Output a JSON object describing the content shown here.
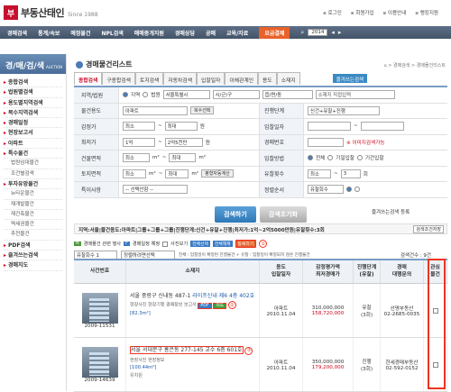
{
  "logo": {
    "mark": "부",
    "name": "부동산태인",
    "since": "Since 1988"
  },
  "toplinks": [
    "로그인",
    "회원가입",
    "이용안내",
    "랭킹지원"
  ],
  "nav": {
    "items": [
      "경매검색",
      "통계/속보",
      "예정물건",
      "NPL검색",
      "매매중개지원",
      "경매상담",
      "공매",
      "교육/자료"
    ],
    "active": "요금결제",
    "year": "2014"
  },
  "sidebar": {
    "title": "경/매/검/색",
    "title_small": "AUCTION",
    "items": [
      {
        "label": "종합검색",
        "type": "main"
      },
      {
        "label": "법원별검색",
        "type": "main"
      },
      {
        "label": "용도별지역검색",
        "type": "main"
      },
      {
        "label": "복수지역검색",
        "type": "main"
      },
      {
        "label": "경매일정",
        "type": "main"
      },
      {
        "label": "현장보고서",
        "type": "main"
      },
      {
        "label": "아파트",
        "type": "main"
      },
      {
        "label": "특수물건",
        "type": "main"
      },
      {
        "label": "법원임대물건",
        "type": "sub"
      },
      {
        "label": "조건별검색",
        "type": "sub"
      },
      {
        "label": "투자유망물건",
        "type": "main"
      },
      {
        "label": "뉴타운물건",
        "type": "sub"
      },
      {
        "label": "재개발물건",
        "type": "sub"
      },
      {
        "label": "재건축물건",
        "type": "sub"
      },
      {
        "label": "역세권물건",
        "type": "sub"
      },
      {
        "label": "추천물건",
        "type": "sub"
      },
      {
        "label": "PDF검색",
        "type": "main"
      },
      {
        "label": "즐겨쓰는검색",
        "type": "main"
      },
      {
        "label": "경매지도",
        "type": "main"
      }
    ]
  },
  "content": {
    "title": "경매물건리스트",
    "breadcrumb": "⌂ > 경매검색 > 경매물건리스트"
  },
  "tabs": [
    "종합검색",
    "구종합검색",
    "토지검색",
    "자동차검색",
    "입찰일자",
    "이해관계인",
    "용도",
    "소재지"
  ],
  "tabs_active": "종합검색",
  "download": "즐겨쓰는검색",
  "form": {
    "r1": {
      "label": "지역/법원",
      "opt1": "지역",
      "opt2": "법원",
      "sel1": "서울특별시",
      "sel2": "시/군/구",
      "sel3": "읍/면/동",
      "placeholder": "소재지 직접입력"
    },
    "r2": {
      "label": "물건용도",
      "sel": "아파트",
      "btn": "복수선택",
      "label2": "진행단계",
      "sel2": "신건+유찰+진행"
    },
    "r3": {
      "label": "감정가",
      "min": "최소",
      "max": "최대",
      "unit": "원",
      "label2": "입찰일자"
    },
    "r4": {
      "label": "최저가",
      "min": "1억",
      "max": "2억5천만",
      "unit": "원",
      "label2": "경매번호",
      "note": "※ 이미지검색가능"
    },
    "r5": {
      "label": "건물면적",
      "min": "최소",
      "max": "최대",
      "unit": "m²",
      "label2": "입찰방법",
      "o1": "전체",
      "o2": "기일입찰",
      "o3": "기간입찰"
    },
    "r6": {
      "label": "토지면적",
      "min": "최소",
      "max": "최대",
      "unit": "m²",
      "btn": "평형자동계산",
      "label2": "유찰횟수",
      "min2": "최소",
      "max2": "3",
      "unit2": "회"
    },
    "r7": {
      "label": "특이사항",
      "sel": "-- 선택안함 --",
      "label2": "정렬순서",
      "sel2": "유찰회수"
    }
  },
  "buttons": {
    "search": "검색하기",
    "reset": "검색초기화"
  },
  "fav": "즐겨쓰는검색 등록",
  "conditions": "지역:서울|물건용도:아파트|그룹+그룹+그룹|진행단계:신건+유찰+진행|최저가:1억~2억5000만원|유찰횟수:3회",
  "conditions_save": "검색조건저장",
  "options": {
    "text1": "경매물건 관련 행사",
    "text2": "경매일정 예정",
    "text3": "사진보기",
    "text4": "전체선택",
    "text5": "전체해제",
    "text6": "등록하기",
    "circ1": "①"
  },
  "sort": {
    "s1": "유찰회수 1",
    "s2": "정렬하려면선택",
    "text": "전체 : 입찰일이 확정된 진행물건 + 유찰 : 입찰일이 확정되지 않은 진행물건"
  },
  "count": "검색건수 : 9건",
  "table": {
    "headers": [
      "사건번호",
      "소재지",
      "용도\n입찰일자",
      "감정평가액\n최저경매가",
      "진행단계\n(유찰)",
      "경매\n대행문의",
      "관심\n물건"
    ],
    "rows": [
      {
        "case": "2009-11531",
        "addr_pre": "서울 중랑구 신내동 487-1 ",
        "addr_link": "라이프신내 제6 4층 402호",
        "sub": "현장사진 현장기행 경매정보 보고서",
        "area": "[82.3m²]",
        "use": "아파트",
        "date": "2010.11.04",
        "price1": "310,000,000",
        "price2": "158,720,000",
        "stage": "유찰",
        "cnt": "(3회)",
        "agent": "선명부동산",
        "phone": "02-2685-0035",
        "circ": "②"
      },
      {
        "case": "2009-14639",
        "addr_pre": "서울 서대문구 홍은동 277-145 교수 6층 601호",
        "addr_link": "",
        "sub": "현장사진 현장정보",
        "area": "[100.44m²]",
        "use": "아파트",
        "date": "2010.11.04",
        "price1": "350,000,000",
        "price2": "179,200,000",
        "stage": "진행",
        "cnt": "(3회)",
        "agent": "한세경매부동산",
        "phone": "02-592-0152",
        "circ": "③",
        "extra": "유치원"
      }
    ]
  }
}
